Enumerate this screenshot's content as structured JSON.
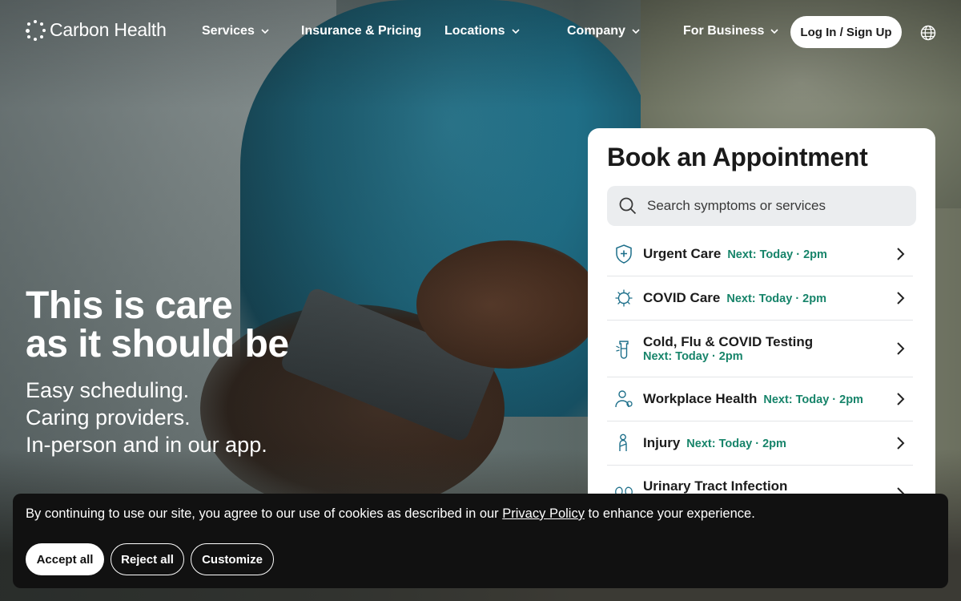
{
  "brand": {
    "name": "Carbon Health"
  },
  "nav": {
    "items": [
      {
        "label": "Services",
        "has_dropdown": true
      },
      {
        "label": "Insurance & Pricing",
        "has_dropdown": false
      },
      {
        "label": "Locations",
        "has_dropdown": true
      },
      {
        "label": "Company",
        "has_dropdown": true
      },
      {
        "label": "For Business",
        "has_dropdown": true
      }
    ],
    "login_label": "Log In / Sign Up",
    "language_icon": "globe-icon"
  },
  "hero": {
    "title_line1": "This is care",
    "title_line2": "as it should be",
    "sub_line1": "Easy scheduling.",
    "sub_line2": "Caring providers.",
    "sub_line3": "In-person and in our app."
  },
  "booking": {
    "title": "Book an Appointment",
    "search_placeholder": "Search symptoms or services",
    "services": [
      {
        "name": "Urgent Care",
        "next": "Next: Today · 2pm",
        "icon": "shield-plus-icon"
      },
      {
        "name": "COVID Care",
        "next": "Next: Today · 2pm",
        "icon": "virus-icon"
      },
      {
        "name": "Cold, Flu & COVID Testing",
        "next": "Next: Today · 2pm",
        "icon": "test-tube-icon"
      },
      {
        "name": "Workplace Health",
        "next": "Next: Today · 2pm",
        "icon": "worker-icon"
      },
      {
        "name": "Injury",
        "next": "Next: Today · 2pm",
        "icon": "bandage-icon"
      },
      {
        "name": "Urinary Tract Infection",
        "next": "",
        "icon": "kidney-icon"
      }
    ]
  },
  "cookie": {
    "text_before": "By continuing to use our site, you agree to our use of cookies as described in our ",
    "link_label": "Privacy Policy",
    "text_after": " to enhance your experience.",
    "accept_label": "Accept all",
    "reject_label": "Reject all",
    "customize_label": "Customize"
  },
  "colors": {
    "accent_green": "#17846a",
    "banner_bg": "#111111",
    "card_bg": "#ffffff"
  }
}
